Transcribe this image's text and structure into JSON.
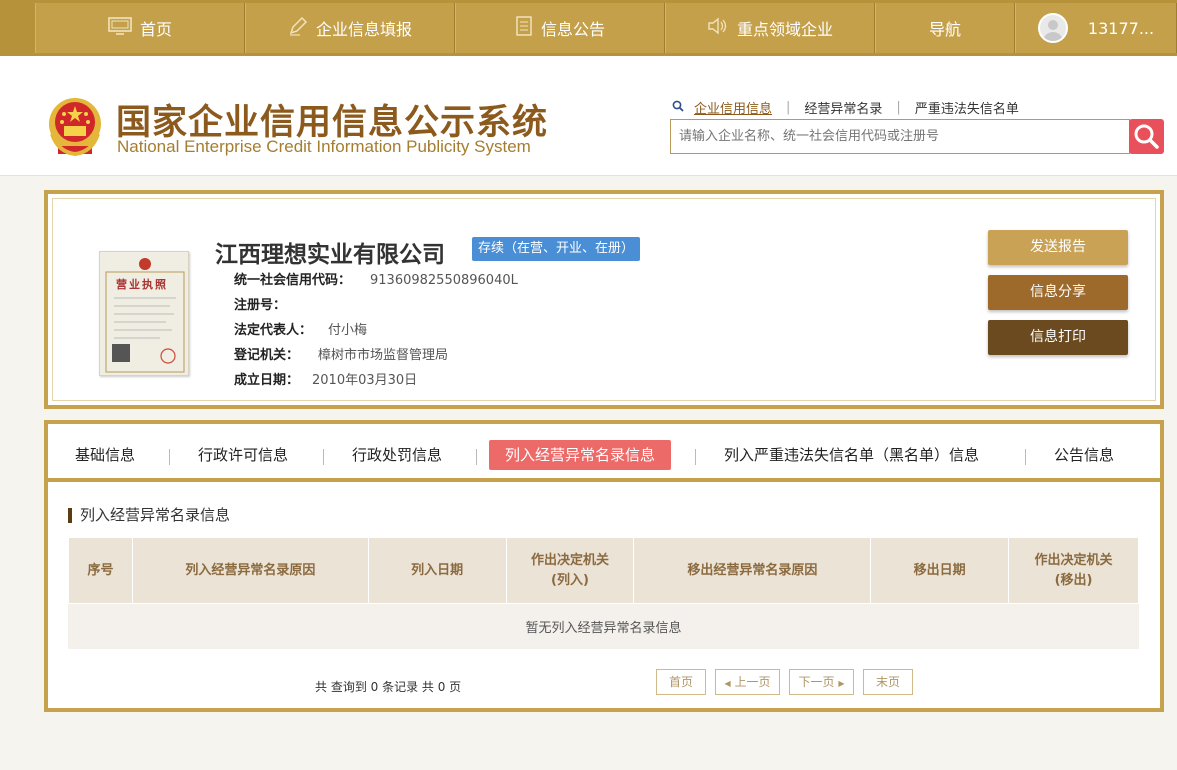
{
  "topnav": {
    "items": [
      {
        "label": "首页",
        "icon": "monitor-icon"
      },
      {
        "label": "企业信息填报",
        "icon": "pen-icon"
      },
      {
        "label": "信息公告",
        "icon": "document-icon"
      },
      {
        "label": "重点领域企业",
        "icon": "speaker-icon"
      },
      {
        "label": "导航"
      }
    ],
    "user": "13177..."
  },
  "header": {
    "title_cn": "国家企业信用信息公示系统",
    "title_en": "National Enterprise Credit Information Publicity System",
    "search_links": [
      "企业信用信息",
      "经营异常名录",
      "严重违法失信名单"
    ],
    "search_placeholder": "请输入企业名称、统一社会信用代码或注册号"
  },
  "company": {
    "name": "江西理想实业有限公司",
    "status": "存续（在营、开业、在册）",
    "license_title": "营业执照",
    "fields": [
      {
        "label": "统一社会信用代码：",
        "value": "91360982550896040L"
      },
      {
        "label": "注册号：",
        "value": ""
      },
      {
        "label": "法定代表人：",
        "value": "付小梅"
      },
      {
        "label": "登记机关：",
        "value": "樟树市市场监督管理局"
      },
      {
        "label": "成立日期：",
        "value": "2010年03月30日"
      }
    ],
    "buttons": [
      "发送报告",
      "信息分享",
      "信息打印"
    ],
    "button_colors": [
      "#c9a255",
      "#9e6a2c",
      "#6a4a1e"
    ]
  },
  "tabs": {
    "items": [
      "基础信息",
      "行政许可信息",
      "行政处罚信息",
      "列入经营异常名录信息",
      "列入严重违法失信名单（黑名单）信息",
      "公告信息"
    ],
    "active": "列入经营异常名录信息"
  },
  "section": {
    "title": "列入经营异常名录信息",
    "columns": [
      "序号",
      "列入经营异常名录原因",
      "列入日期",
      "作出决定机关\n(列入)",
      "移出经营异常名录原因",
      "移出日期",
      "作出决定机关\n(移出)"
    ],
    "empty_text": "暂无列入经营异常名录信息"
  },
  "pager": {
    "info": "共 查询到 0 条记录 共 0 页",
    "first": "首页",
    "prev": "上一页",
    "next": "下一页",
    "last": "末页"
  },
  "colors": {
    "gold": "#c6a24d",
    "active_tab": "#ec6a68",
    "badge": "#4a8fd6",
    "search_button": "#e8505b"
  }
}
